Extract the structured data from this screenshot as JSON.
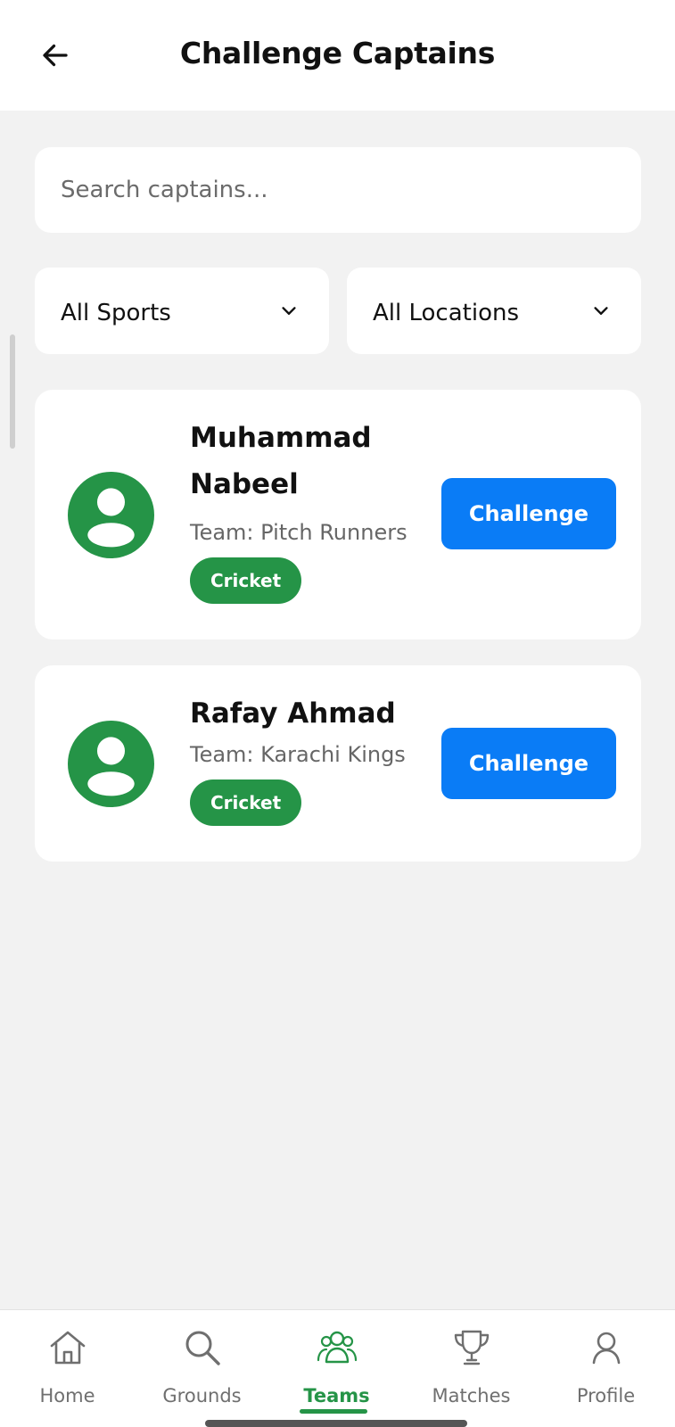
{
  "header": {
    "title": "Challenge Captains",
    "back_icon": "arrow-left-icon"
  },
  "search": {
    "placeholder": "Search captains...",
    "value": ""
  },
  "filters": {
    "sport": {
      "selected": "All Sports",
      "icon": "chevron-down-icon"
    },
    "location": {
      "selected": "All Locations",
      "icon": "chevron-down-icon"
    }
  },
  "captains": [
    {
      "name": "Muhammad Nabeel",
      "team": "Team: Pitch Runners",
      "sport": "Cricket",
      "action_label": "Challenge",
      "avatar_icon": "user-avatar-icon"
    },
    {
      "name": "Rafay Ahmad",
      "team": "Team: Karachi Kings",
      "sport": "Cricket",
      "action_label": "Challenge",
      "avatar_icon": "user-avatar-icon"
    }
  ],
  "bottom_nav": {
    "items": [
      {
        "label": "Home",
        "icon": "home-icon",
        "active": false
      },
      {
        "label": "Grounds",
        "icon": "search-icon",
        "active": false
      },
      {
        "label": "Teams",
        "icon": "teams-icon",
        "active": true
      },
      {
        "label": "Matches",
        "icon": "trophy-icon",
        "active": false
      },
      {
        "label": "Profile",
        "icon": "profile-icon",
        "active": false
      }
    ]
  },
  "colors": {
    "brand_green": "#259447",
    "action_blue": "#0a7cf6",
    "background": "#f2f2f2",
    "surface": "#ffffff"
  }
}
